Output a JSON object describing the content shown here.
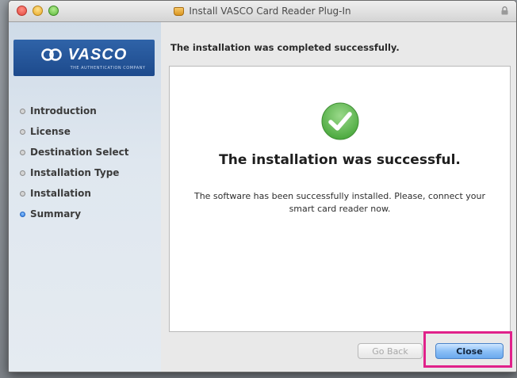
{
  "window": {
    "title": "Install VASCO Card Reader Plug-In"
  },
  "sidebar": {
    "logo": {
      "text": "VASCO",
      "tagline": "The Authentication Company"
    },
    "steps": [
      {
        "label": "Introduction",
        "state": "done"
      },
      {
        "label": "License",
        "state": "done"
      },
      {
        "label": "Destination Select",
        "state": "done"
      },
      {
        "label": "Installation Type",
        "state": "done"
      },
      {
        "label": "Installation",
        "state": "done"
      },
      {
        "label": "Summary",
        "state": "current"
      }
    ]
  },
  "main": {
    "header": "The installation was completed successfully.",
    "status_icon": "checkmark-circle-icon",
    "heading": "The installation was successful.",
    "message": "The software has been successfully installed. Please, connect your smart card reader now."
  },
  "footer": {
    "back_label": "Go Back",
    "back_enabled": false,
    "close_label": "Close"
  },
  "colors": {
    "accent": "#6aa9ee",
    "success": "#5cb85c",
    "highlight": "#e0218a",
    "brand": "#1d4a8c"
  }
}
